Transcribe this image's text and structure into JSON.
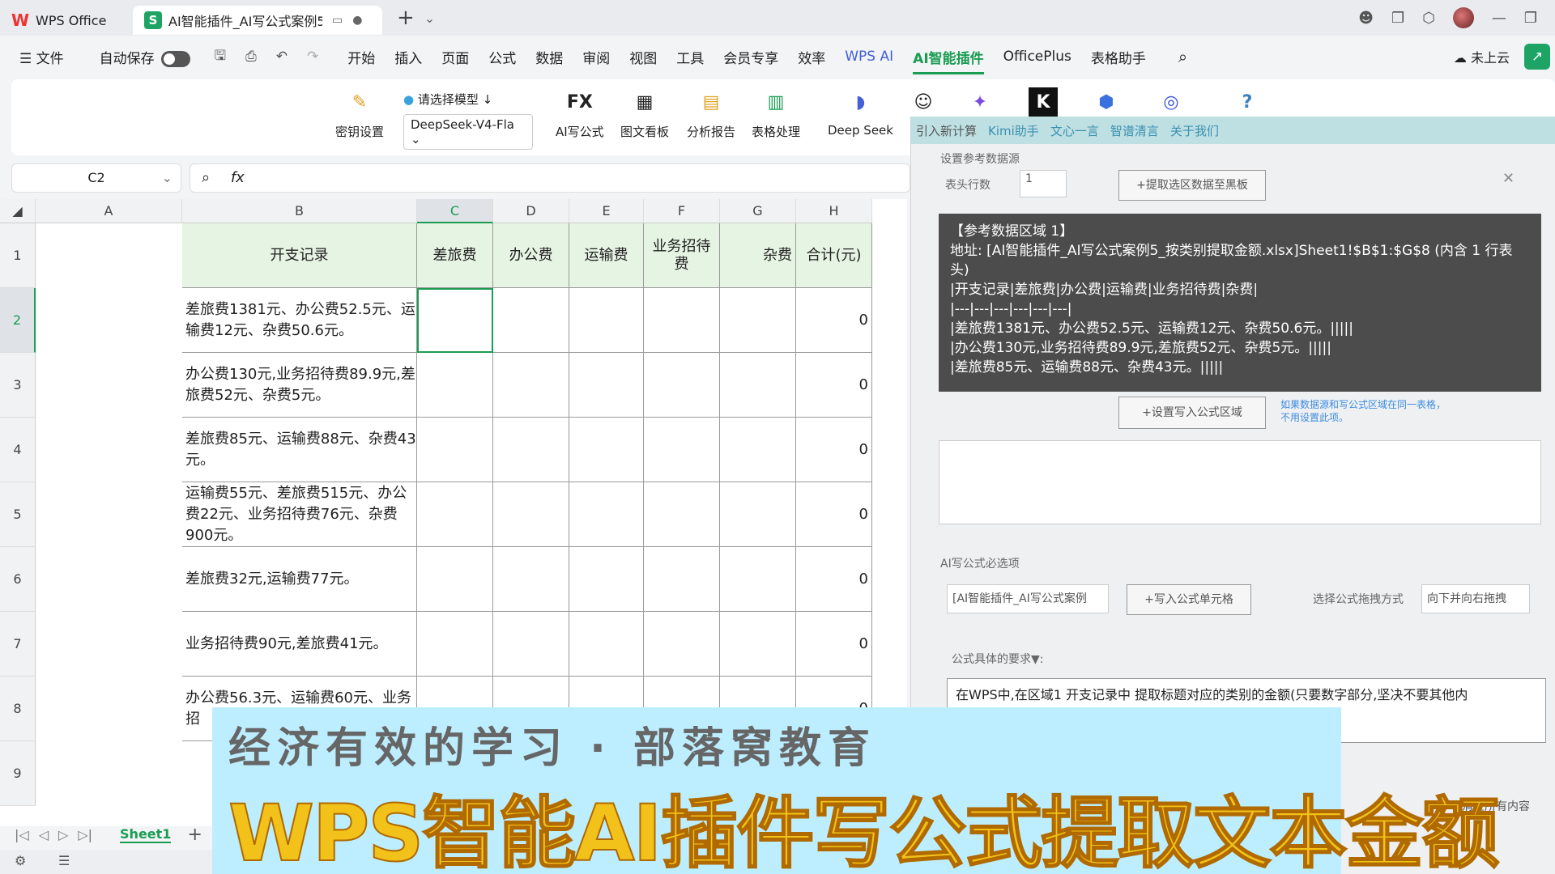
{
  "titlebar": {
    "app_tab": "WPS Office",
    "doc_tab": "AI智能插件_AI写公式案例5"
  },
  "menubar": {
    "file": "文件",
    "autosave": "自动保存",
    "items": [
      "开始",
      "插入",
      "页面",
      "公式",
      "数据",
      "审阅",
      "视图",
      "工具",
      "会员专享",
      "效率",
      "WPS AI",
      "AI智能插件",
      "OfficePlus",
      "表格助手"
    ],
    "active": "AI智能插件",
    "cloud": "未上云"
  },
  "ribbon": {
    "key_settings": "密钥设置",
    "model_label": "请选择模型",
    "model_value": "DeepSeek-V4-Fla",
    "ai_formula": "AI写公式",
    "chart_board": "图文看板",
    "analysis_report": "分析报告",
    "table_processing": "表格处理",
    "deepseek": "Deep Seek",
    "fx_icon_text": "FX"
  },
  "formula_bar": {
    "cell_ref": "C2",
    "fx": "fx"
  },
  "grid": {
    "columns": [
      "A",
      "B",
      "C",
      "D",
      "E",
      "F",
      "G",
      "H"
    ],
    "selected_column": "C",
    "rows": [
      "1",
      "2",
      "3",
      "4",
      "5",
      "6",
      "7",
      "8",
      "9"
    ],
    "selected_row": "2",
    "headers": [
      "开支记录",
      "差旅费",
      "办公费",
      "运输费",
      "业务招待费",
      "杂费",
      "合计(元)"
    ],
    "records": [
      "差旅费1381元、办公费52.5元、运输费12元、杂费50.6元。",
      "办公费130元,业务招待费89.9元,差旅费52元、杂费5元。",
      "差旅费85元、运输费88元、杂费43元。",
      "运输费55元、差旅费515元、办公费22元、业务招待费76元、杂费900元。",
      "差旅费32元,运输费77元。",
      "业务招待费90元,差旅费41元。",
      "办公费56.3元、运输费60元、业务招"
    ],
    "totals": [
      "0",
      "0",
      "0",
      "0",
      "0",
      "0",
      "0"
    ]
  },
  "sheets": {
    "active": "Sheet1"
  },
  "panel": {
    "tabs": [
      "引入新计算",
      "Kimi助手",
      "文心一言",
      "智谱清言",
      "关于我们"
    ],
    "section1": "设置参考数据源",
    "header_rows_label": "表头行数",
    "header_rows_value": "1",
    "extract_btn": "+提取选区数据至黑板",
    "ref_title": "【参考数据区域 1】",
    "ref_address": "地址: [AI智能插件_AI写公式案例5_按类别提取金额.xlsx]Sheet1!$B$1:$G$8 (内含 1 行表头)",
    "ref_lines": [
      "|开支记录|差旅费|办公费|运输费|业务招待费|杂费|",
      "|---|---|---|---|---|---|",
      "|差旅费1381元、办公费52.5元、运输费12元、杂费50.6元。|||||",
      "|办公费130元,业务招待费89.9元,差旅费52元、杂费5元。|||||",
      "|差旅费85元、运输费88元、杂费43元。|||||"
    ],
    "set_write_btn": "+设置写入公式区域",
    "write_hint": "如果数据源和写公式区域在同一表格，不用设置此项。",
    "section2": "AI写公式必选项",
    "file_input": "[AI智能插件_AI写公式案例",
    "write_cell_btn": "+写入公式单元格",
    "drag_label": "选择公式拖拽方式",
    "drag_value": "向下并向右拖拽",
    "req_label": "公式具体的要求▼:",
    "req_text": "在WPS中,在区域1 开支记录中 提取标题对应的类别的金额(只要数字部分,坚决不要其他内",
    "clear_btn": "清空所有内容"
  },
  "caption": {
    "line1": "经济有效的学习 · 部落窝教育",
    "line2": "WPS智能AI插件写公式提取文本金额"
  }
}
